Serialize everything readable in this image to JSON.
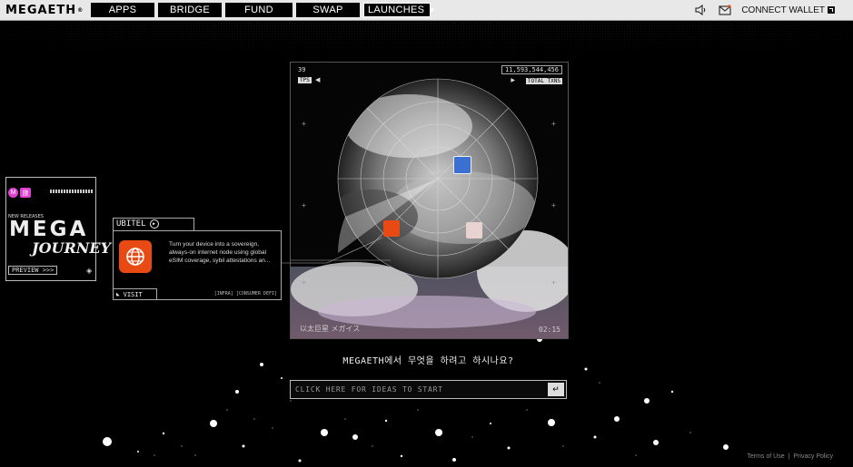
{
  "nav": {
    "logo": "MEGAETH",
    "logo_mark": "®",
    "items": [
      "APPS",
      "BRIDGE",
      "FUND",
      "SWAP"
    ],
    "launches": "LAUNCHES",
    "connect_wallet": "CONNECT WALLET",
    "icons": [
      "sound-icon",
      "mail-icon"
    ]
  },
  "panel": {
    "tps_value": "39",
    "tps_label": "TPS",
    "txns_value": "11,593,544,456",
    "txns_label": "TOTAL TXNS",
    "footer_left": "以太巨星 メガイス",
    "footer_right": "02:15"
  },
  "release_card": {
    "label": "NEW RELEASES",
    "badge_m": "M",
    "badge_kanji": "旅",
    "title_top": "MEGA",
    "title_bottom": "JOURNEY",
    "preview": "PREVIEW >>>"
  },
  "app_card": {
    "name": "UBITEL",
    "description": "Turn your device into a sovereign, always-on internet node using global eSIM coverage, sybil attestations an...",
    "visit": "VISIT",
    "tags": "[INFRA] [CONSUMER DEFI]",
    "accent": "#e94a14"
  },
  "prompt": {
    "question": "MEGAETH에서 무엇을 하려고 하시나요?",
    "placeholder": "CLICK HERE FOR IDEAS TO START",
    "enter_symbol": "↵"
  },
  "footer": {
    "terms": "Terms of Use",
    "separator": "|",
    "privacy": "Privacy Policy"
  }
}
